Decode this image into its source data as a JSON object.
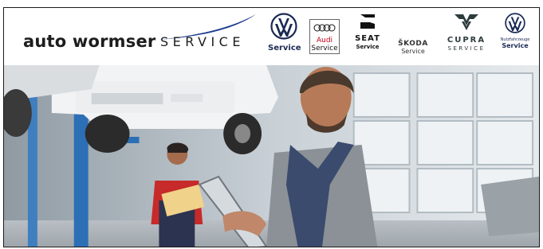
{
  "header": {
    "logo_main": "auto wormser",
    "logo_service": "SERVICE"
  },
  "brands": {
    "vw": {
      "icon": "vw-logo-icon",
      "caption": "Service"
    },
    "audi": {
      "icon": "audi-rings-icon",
      "caption_brand": "Audi",
      "caption": "Service"
    },
    "seat": {
      "icon": "seat-logo-icon",
      "wordmark": "SEAT",
      "caption": "Service"
    },
    "skoda": {
      "wordmark": "ŠKODA",
      "caption": "Service"
    },
    "cupra": {
      "icon": "cupra-logo-icon",
      "wordmark": "CUPRA",
      "caption": "SERVICE"
    },
    "vw_nutzfahrzeuge": {
      "icon": "vw-logo-icon",
      "sub": "Nutzfahrzeuge",
      "caption": "Service"
    }
  },
  "colors": {
    "vw_blue": "#1a2a55",
    "swoosh_blue": "#1e3f8f",
    "audi_red": "#c00019",
    "cupra_copper": "#2e3b3d"
  },
  "photo": {
    "icon": "workshop-mechanics-photo"
  }
}
